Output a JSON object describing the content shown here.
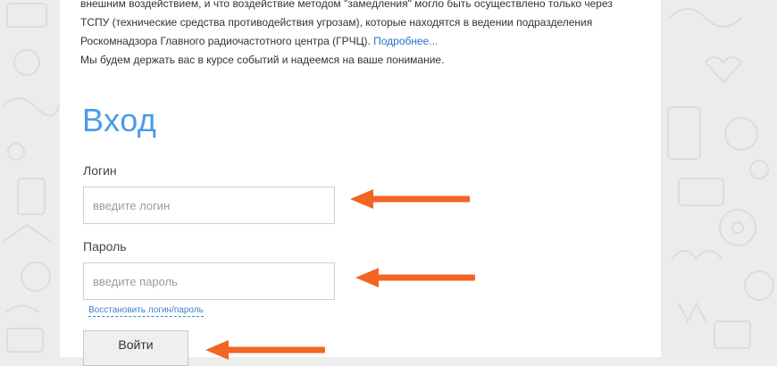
{
  "notice": {
    "line1": "внешним воздействием, и что воздействие методом \"замедления\" могло быть осуществлено только через",
    "line2": "ТСПУ (технические средства противодействия угрозам), которые находятся в ведении подразделения",
    "line3": "Роскомнадзора Главного радиочастотного центра (ГРЧЦ).",
    "more_link": "Подробнее...",
    "line4": "Мы будем держать вас в курсе событий и надеемся на ваше понимание."
  },
  "login_form": {
    "title": "Вход",
    "login_label": "Логин",
    "login_placeholder": "введите логин",
    "login_value": "",
    "password_label": "Пароль",
    "password_placeholder": "введите пароль",
    "password_value": "",
    "restore_link": "Восстановить логин/пароль",
    "submit_label": "Войти"
  },
  "colors": {
    "title": "#4b9be8",
    "link": "#2a72c8",
    "arrow": "#f26522",
    "background": "#ececec"
  }
}
